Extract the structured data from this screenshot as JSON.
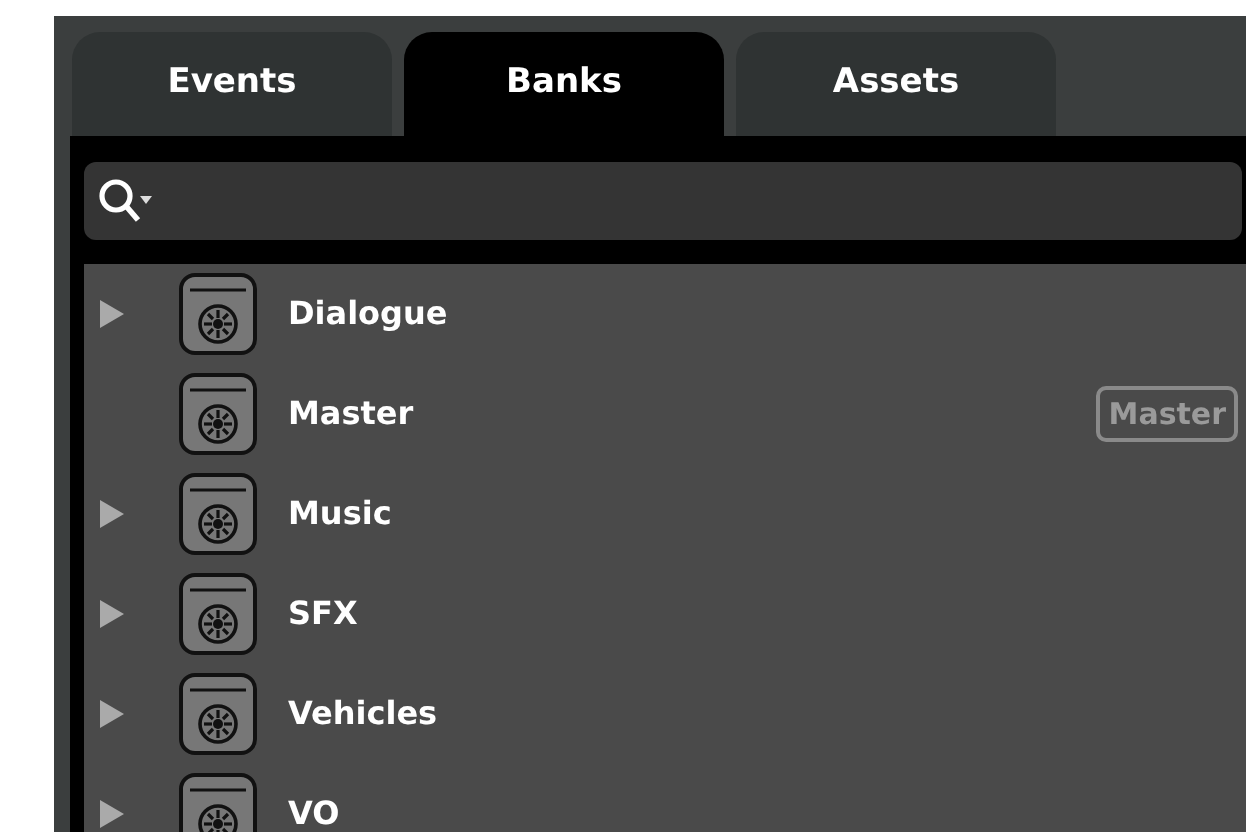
{
  "tabs": [
    {
      "label": "Events",
      "selected": false
    },
    {
      "label": "Banks",
      "selected": true
    },
    {
      "label": "Assets",
      "selected": false
    }
  ],
  "banks": [
    {
      "name": "Dialogue",
      "expandable": true
    },
    {
      "name": "Master",
      "expandable": false,
      "badge": "Master"
    },
    {
      "name": "Music",
      "expandable": true
    },
    {
      "name": "SFX",
      "expandable": true
    },
    {
      "name": "Vehicles",
      "expandable": true
    },
    {
      "name": "VO",
      "expandable": true
    }
  ]
}
